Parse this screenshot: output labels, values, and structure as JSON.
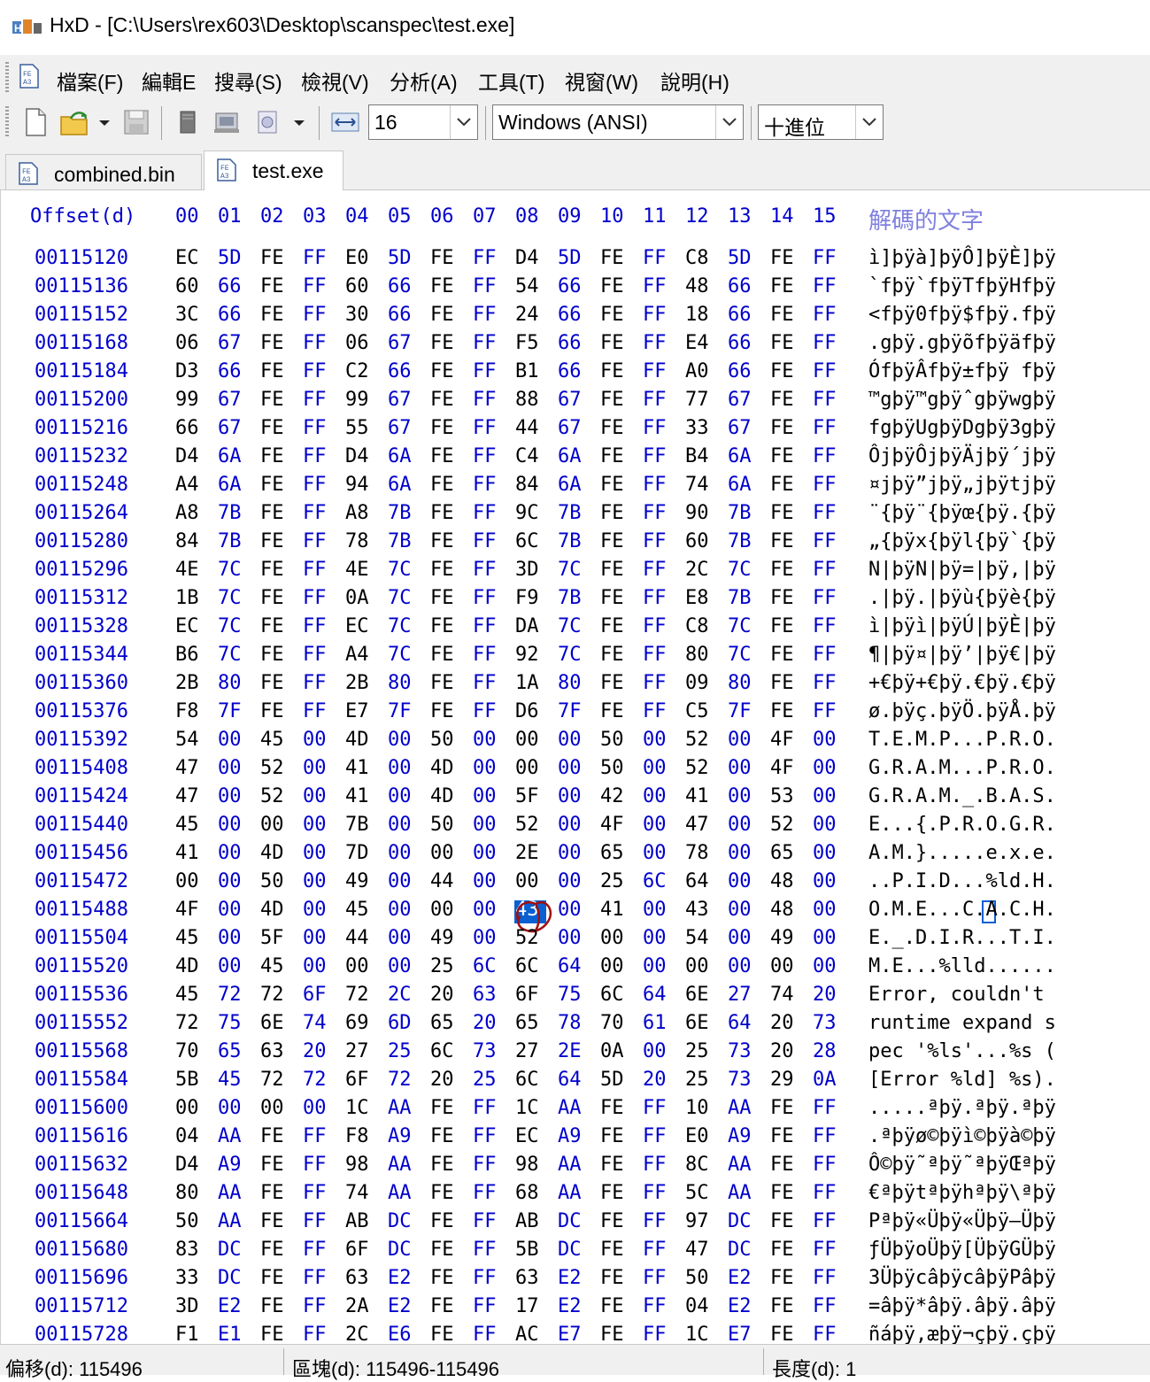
{
  "window": {
    "title": "HxD - [C:\\Users\\rex603\\Desktop\\scanspec\\test.exe]"
  },
  "menu": [
    "檔案(F)",
    "編輯E",
    "搜尋(S)",
    "檢視(V)",
    "分析(A)",
    "工具(T)",
    "視窗(W)",
    "說明(H)"
  ],
  "toolbar": {
    "bytes_per_row": "16",
    "charset": "Windows (ANSI)",
    "offset_base": "十進位"
  },
  "tabs": [
    {
      "label": "combined.bin",
      "active": false
    },
    {
      "label": "test.exe",
      "active": true
    }
  ],
  "editor": {
    "offset_header": "Offset(d)",
    "column_headers": [
      "00",
      "01",
      "02",
      "03",
      "04",
      "05",
      "06",
      "07",
      "08",
      "09",
      "10",
      "11",
      "12",
      "13",
      "14",
      "15"
    ],
    "text_header": "解碼的文字",
    "rows": [
      {
        "offset": "00115120",
        "hex": "EC 5D FE FF E0 5D FE FF D4 5D FE FF C8 5D FE FF",
        "text": "ì]þÿà]þÿÔ]þÿÈ]þÿ"
      },
      {
        "offset": "00115136",
        "hex": "60 66 FE FF 60 66 FE FF 54 66 FE FF 48 66 FE FF",
        "text": "`fþÿ`fþÿTfþÿHfþÿ"
      },
      {
        "offset": "00115152",
        "hex": "3C 66 FE FF 30 66 FE FF 24 66 FE FF 18 66 FE FF",
        "text": "<fþÿ0fþÿ$fþÿ.fþÿ"
      },
      {
        "offset": "00115168",
        "hex": "06 67 FE FF 06 67 FE FF F5 66 FE FF E4 66 FE FF",
        "text": ".gþÿ.gþÿõfþÿäfþÿ"
      },
      {
        "offset": "00115184",
        "hex": "D3 66 FE FF C2 66 FE FF B1 66 FE FF A0 66 FE FF",
        "text": "ÓfþÿÂfþÿ±fþÿ fþÿ"
      },
      {
        "offset": "00115200",
        "hex": "99 67 FE FF 99 67 FE FF 88 67 FE FF 77 67 FE FF",
        "text": "™gþÿ™gþÿˆgþÿwgþÿ"
      },
      {
        "offset": "00115216",
        "hex": "66 67 FE FF 55 67 FE FF 44 67 FE FF 33 67 FE FF",
        "text": "fgþÿUgþÿDgþÿ3gþÿ"
      },
      {
        "offset": "00115232",
        "hex": "D4 6A FE FF D4 6A FE FF C4 6A FE FF B4 6A FE FF",
        "text": "ÔjþÿÔjþÿÄjþÿ´jþÿ"
      },
      {
        "offset": "00115248",
        "hex": "A4 6A FE FF 94 6A FE FF 84 6A FE FF 74 6A FE FF",
        "text": "¤jþÿ”jþÿ„jþÿtjþÿ"
      },
      {
        "offset": "00115264",
        "hex": "A8 7B FE FF A8 7B FE FF 9C 7B FE FF 90 7B FE FF",
        "text": "¨{þÿ¨{þÿœ{þÿ.{þÿ"
      },
      {
        "offset": "00115280",
        "hex": "84 7B FE FF 78 7B FE FF 6C 7B FE FF 60 7B FE FF",
        "text": "„{þÿx{þÿl{þÿ`{þÿ"
      },
      {
        "offset": "00115296",
        "hex": "4E 7C FE FF 4E 7C FE FF 3D 7C FE FF 2C 7C FE FF",
        "text": "N|þÿN|þÿ=|þÿ,|þÿ"
      },
      {
        "offset": "00115312",
        "hex": "1B 7C FE FF 0A 7C FE FF F9 7B FE FF E8 7B FE FF",
        "text": ".|þÿ.|þÿù{þÿè{þÿ"
      },
      {
        "offset": "00115328",
        "hex": "EC 7C FE FF EC 7C FE FF DA 7C FE FF C8 7C FE FF",
        "text": "ì|þÿì|þÿÚ|þÿÈ|þÿ"
      },
      {
        "offset": "00115344",
        "hex": "B6 7C FE FF A4 7C FE FF 92 7C FE FF 80 7C FE FF",
        "text": "¶|þÿ¤|þÿ’|þÿ€|þÿ"
      },
      {
        "offset": "00115360",
        "hex": "2B 80 FE FF 2B 80 FE FF 1A 80 FE FF 09 80 FE FF",
        "text": "+€þÿ+€þÿ.€þÿ.€þÿ"
      },
      {
        "offset": "00115376",
        "hex": "F8 7F FE FF E7 7F FE FF D6 7F FE FF C5 7F FE FF",
        "text": "ø.þÿç.þÿÖ.þÿÅ.þÿ"
      },
      {
        "offset": "00115392",
        "hex": "54 00 45 00 4D 00 50 00 00 00 50 00 52 00 4F 00",
        "text": "T.E.M.P...P.R.O."
      },
      {
        "offset": "00115408",
        "hex": "47 00 52 00 41 00 4D 00 00 00 50 00 52 00 4F 00",
        "text": "G.R.A.M...P.R.O."
      },
      {
        "offset": "00115424",
        "hex": "47 00 52 00 41 00 4D 00 5F 00 42 00 41 00 53 00",
        "text": "G.R.A.M._.B.A.S."
      },
      {
        "offset": "00115440",
        "hex": "45 00 00 00 7B 00 50 00 52 00 4F 00 47 00 52 00",
        "text": "E...{.P.R.O.G.R."
      },
      {
        "offset": "00115456",
        "hex": "41 00 4D 00 7D 00 00 00 2E 00 65 00 78 00 65 00",
        "text": "A.M.}.....e.x.e."
      },
      {
        "offset": "00115472",
        "hex": "00 00 50 00 49 00 44 00 00 00 25 6C 64 00 48 00",
        "text": "..P.I.D...%ld.H."
      },
      {
        "offset": "00115488",
        "hex": "4F 00 4D 00 45 00 00 00 43 00 41 00 43 00 48 00",
        "text": "O.M.E...C.A.C.H."
      },
      {
        "offset": "00115504",
        "hex": "45 00 5F 00 44 00 49 00 52 00 00 00 54 00 49 00",
        "text": "E._.D.I.R...T.I."
      },
      {
        "offset": "00115520",
        "hex": "4D 00 45 00 00 00 25 6C 6C 64 00 00 00 00 00 00",
        "text": "M.E...%lld......"
      },
      {
        "offset": "00115536",
        "hex": "45 72 72 6F 72 2C 20 63 6F 75 6C 64 6E 27 74 20",
        "text": "Error, couldn't "
      },
      {
        "offset": "00115552",
        "hex": "72 75 6E 74 69 6D 65 20 65 78 70 61 6E 64 20 73",
        "text": "runtime expand s"
      },
      {
        "offset": "00115568",
        "hex": "70 65 63 20 27 25 6C 73 27 2E 0A 00 25 73 20 28",
        "text": "pec '%ls'...%s ("
      },
      {
        "offset": "00115584",
        "hex": "5B 45 72 72 6F 72 20 25 6C 64 5D 20 25 73 29 0A",
        "text": "[Error %ld] %s)."
      },
      {
        "offset": "00115600",
        "hex": "00 00 00 00 1C AA FE FF 1C AA FE FF 10 AA FE FF",
        "text": ".....ªþÿ.ªþÿ.ªþÿ"
      },
      {
        "offset": "00115616",
        "hex": "04 AA FE FF F8 A9 FE FF EC A9 FE FF E0 A9 FE FF",
        "text": ".ªþÿø©þÿì©þÿà©þÿ"
      },
      {
        "offset": "00115632",
        "hex": "D4 A9 FE FF 98 AA FE FF 98 AA FE FF 8C AA FE FF",
        "text": "Ô©þÿ˜ªþÿ˜ªþÿŒªþÿ"
      },
      {
        "offset": "00115648",
        "hex": "80 AA FE FF 74 AA FE FF 68 AA FE FF 5C AA FE FF",
        "text": "€ªþÿtªþÿhªþÿ\\ªþÿ"
      },
      {
        "offset": "00115664",
        "hex": "50 AA FE FF AB DC FE FF AB DC FE FF 97 DC FE FF",
        "text": "Pªþÿ«Üþÿ«Üþÿ—Üþÿ"
      },
      {
        "offset": "00115680",
        "hex": "83 DC FE FF 6F DC FE FF 5B DC FE FF 47 DC FE FF",
        "text": "ƒÜþÿoÜþÿ[ÜþÿGÜþÿ"
      },
      {
        "offset": "00115696",
        "hex": "33 DC FE FF 63 E2 FE FF 63 E2 FE FF 50 E2 FE FF",
        "text": "3ÜþÿcâþÿcâþÿPâþÿ"
      },
      {
        "offset": "00115712",
        "hex": "3D E2 FE FF 2A E2 FE FF 17 E2 FE FF 04 E2 FE FF",
        "text": "=âþÿ*âþÿ.âþÿ.âþÿ"
      },
      {
        "offset": "00115728",
        "hex": "F1 E1 FE FF 2C E6 FE FF AC E7 FE FF 1C E7 FE FF",
        "text": "ñáþÿ,æþÿ¬çþÿ.çþÿ"
      }
    ]
  },
  "status": {
    "offset": "偏移(d): 115496",
    "block": "區塊(d): 115496-115496",
    "length": "長度(d): 1"
  }
}
